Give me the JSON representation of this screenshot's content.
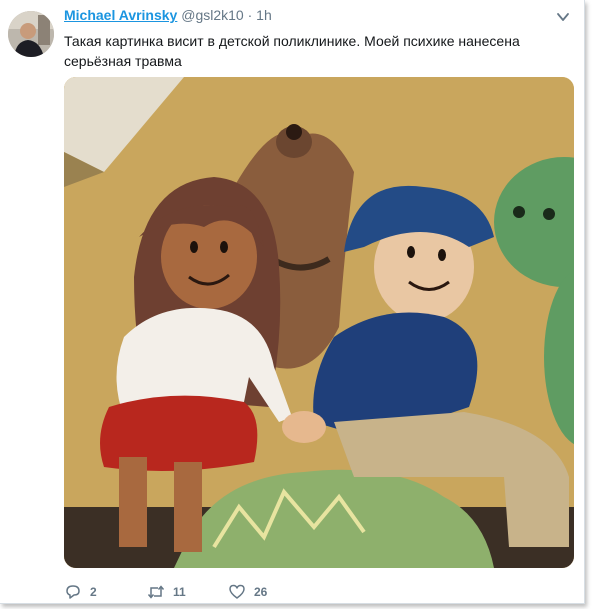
{
  "tweet": {
    "author_name": "Michael Avrinsky",
    "handle": "@gsl2k10",
    "separator": "·",
    "time": "1h",
    "text": "Такая картинка висит в детской поликлинике. Моей психике нанесена серьёзная травма",
    "replies": "2",
    "retweets": "11",
    "likes": "26"
  },
  "icons": {
    "more": "chevron-down-icon",
    "reply": "reply-icon",
    "retweet": "retweet-icon",
    "like": "heart-icon"
  },
  "colors": {
    "link": "#1b95e0",
    "secondary": "#657786",
    "text": "#14171a"
  }
}
